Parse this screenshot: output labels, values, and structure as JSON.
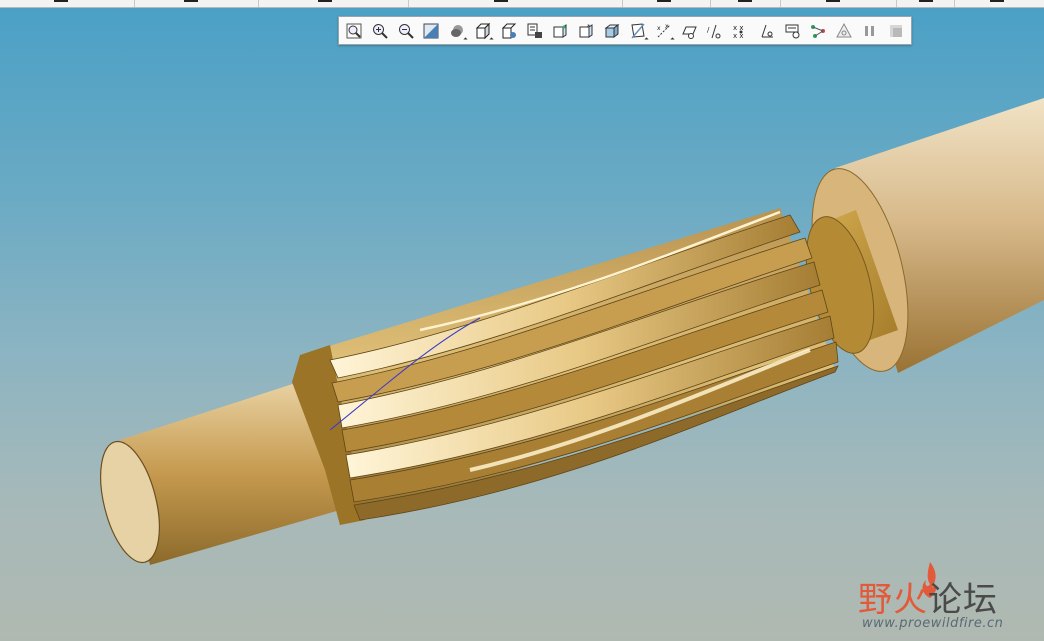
{
  "toolbar": {
    "buttons": [
      {
        "icon": "zoom-fit-icon",
        "label": "Refit"
      },
      {
        "icon": "zoom-in-icon",
        "label": "Zoom In"
      },
      {
        "icon": "zoom-out-icon",
        "label": "Zoom Out"
      },
      {
        "icon": "repaint-icon",
        "label": "Repaint"
      },
      {
        "icon": "display-style-icon",
        "label": "Display Style"
      },
      {
        "icon": "saved-views-icon",
        "label": "Saved Orientations"
      },
      {
        "icon": "view-manager-icon",
        "label": "View Manager"
      },
      {
        "icon": "layers-icon",
        "label": "Layers"
      },
      {
        "icon": "perspective-icon",
        "label": "Perspective View"
      },
      {
        "icon": "spin-center-icon",
        "label": "Spin Center"
      },
      {
        "icon": "section-view-icon",
        "label": "Section"
      },
      {
        "icon": "plane-display-icon",
        "label": "Plane Display"
      },
      {
        "icon": "axis-display-icon",
        "label": "Axis Display"
      },
      {
        "icon": "plane-tag-icon",
        "label": "Plane Tag"
      },
      {
        "icon": "point-display-icon",
        "label": "Point Display"
      },
      {
        "icon": "point-tag-icon",
        "label": "Point Tag"
      },
      {
        "icon": "csys-display-icon",
        "label": "Csys Display"
      },
      {
        "icon": "annotation-display-icon",
        "label": "Annotation Display"
      },
      {
        "icon": "connector-icon",
        "label": "Connector"
      },
      {
        "icon": "warning-triangle-icon",
        "label": "Warning"
      },
      {
        "icon": "pause-icon",
        "label": "Pause"
      },
      {
        "icon": "restore-icon",
        "label": "Restore"
      }
    ]
  },
  "watermark": {
    "title_part1": "野火",
    "title_part2": "论坛",
    "url": "www.proewildfire.cn",
    "accent_color": "#e25a3a"
  },
  "colors": {
    "background_top": "#4aa0c6",
    "background_bottom": "#b0b9b1",
    "model_gold": "#c9a255"
  }
}
